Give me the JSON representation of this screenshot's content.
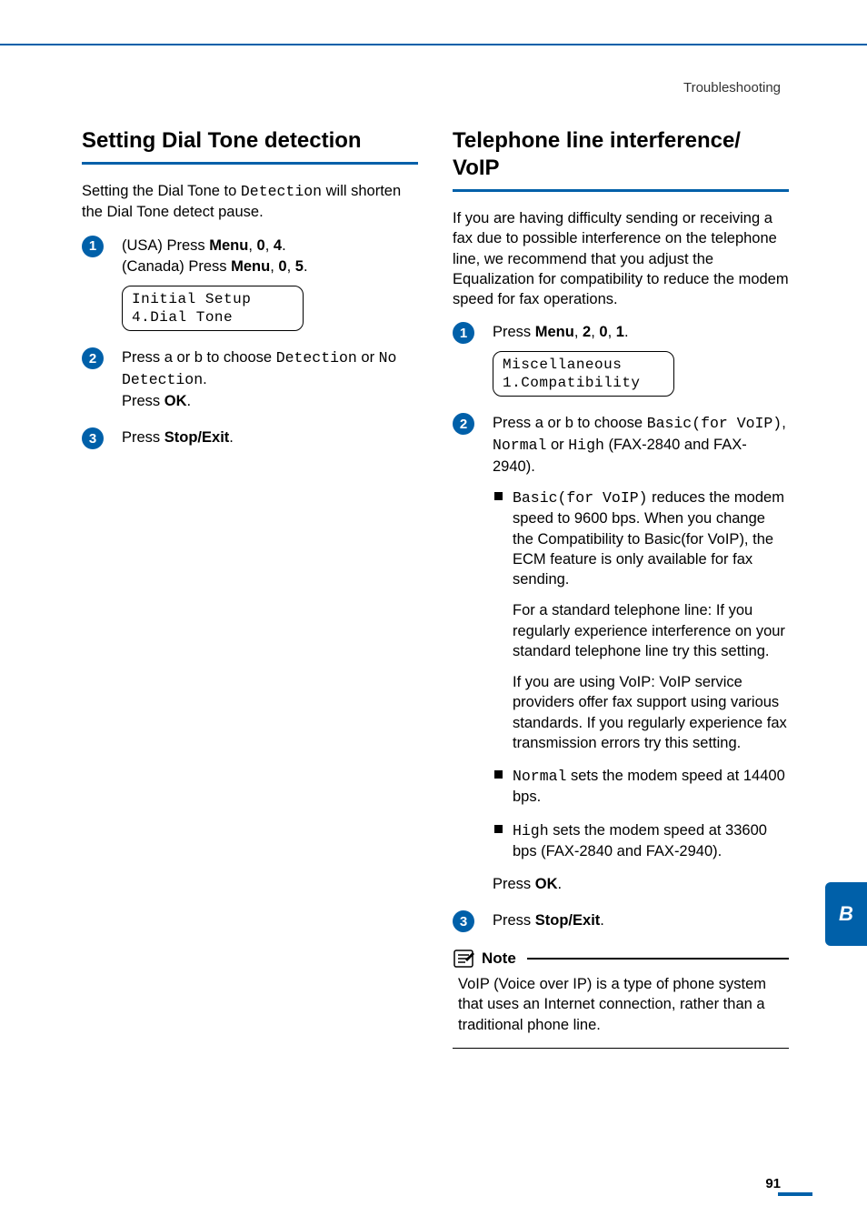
{
  "header": {
    "breadcrumb": "Troubleshooting"
  },
  "left": {
    "title": "Setting Dial Tone detection",
    "intro_pre": "Setting the Dial Tone to ",
    "intro_mono": "Detection",
    "intro_post": " will shorten the Dial Tone detect pause.",
    "step1": {
      "linea_pre": "(USA) Press ",
      "linea_b1": "Menu",
      "linea_s1": ", ",
      "linea_b2": "0",
      "linea_s2": ", ",
      "linea_b3": "4",
      "linea_s3": ".",
      "lineb_pre": "(Canada) Press ",
      "lineb_b1": "Menu",
      "lineb_s1": ", ",
      "lineb_b2": "0",
      "lineb_s2": ", ",
      "lineb_b3": "5",
      "lineb_s3": ".",
      "lcd1": "Initial Setup",
      "lcd2": "4.Dial Tone"
    },
    "step2": {
      "pre": "Press a or b to choose ",
      "opt1": "Detection",
      "mid": " or ",
      "opt2": "No Detection",
      "post1": ".",
      "press": "Press ",
      "ok": "OK",
      "post2": "."
    },
    "step3": {
      "pre": "Press ",
      "btn": "Stop/Exit",
      "post": "."
    }
  },
  "right": {
    "title": "Telephone line interference/ VoIP",
    "intro": "If you are having difficulty sending or receiving a fax due to possible interference on the telephone line, we recommend that you adjust the Equalization for compatibility to reduce the modem speed for fax operations.",
    "step1": {
      "pre": "Press ",
      "b1": "Menu",
      "s1": ", ",
      "b2": "2",
      "s2": ", ",
      "b3": "0",
      "s3": ", ",
      "b4": "1",
      "s4": ".",
      "lcd1": "Miscellaneous",
      "lcd2": "1.Compatibility"
    },
    "step2": {
      "pre": "Press a or b to choose ",
      "opt1": "Basic(for VoIP)",
      "s1": ", ",
      "opt2": "Normal",
      "mid": " or ",
      "opt3": "High",
      "tail": " (FAX-2840 and FAX-2940).",
      "bullet1_mono": "Basic(for VoIP)",
      "bullet1_text": " reduces the modem speed to 9600 bps. When you change the Compatibility to Basic(for VoIP), the ECM feature is only available for fax sending.",
      "bullet1_p2": "For a standard telephone line: If you regularly experience interference on your standard telephone line try this setting.",
      "bullet1_p3": "If you are using VoIP: VoIP service providers offer fax support using various standards. If you regularly experience fax transmission errors try this setting.",
      "bullet2_mono": "Normal",
      "bullet2_text": " sets the modem speed at 14400 bps.",
      "bullet3_mono": "High",
      "bullet3_text": " sets the modem speed at 33600 bps (FAX-2840 and FAX-2940).",
      "press": "Press ",
      "ok": "OK",
      "post": "."
    },
    "step3": {
      "pre": "Press ",
      "btn": "Stop/Exit",
      "post": "."
    },
    "note_label": "Note",
    "note_body": "VoIP (Voice over IP) is a type of phone system that uses an Internet connection, rather than a traditional phone line."
  },
  "sidetab": "B",
  "pagenum": "91"
}
